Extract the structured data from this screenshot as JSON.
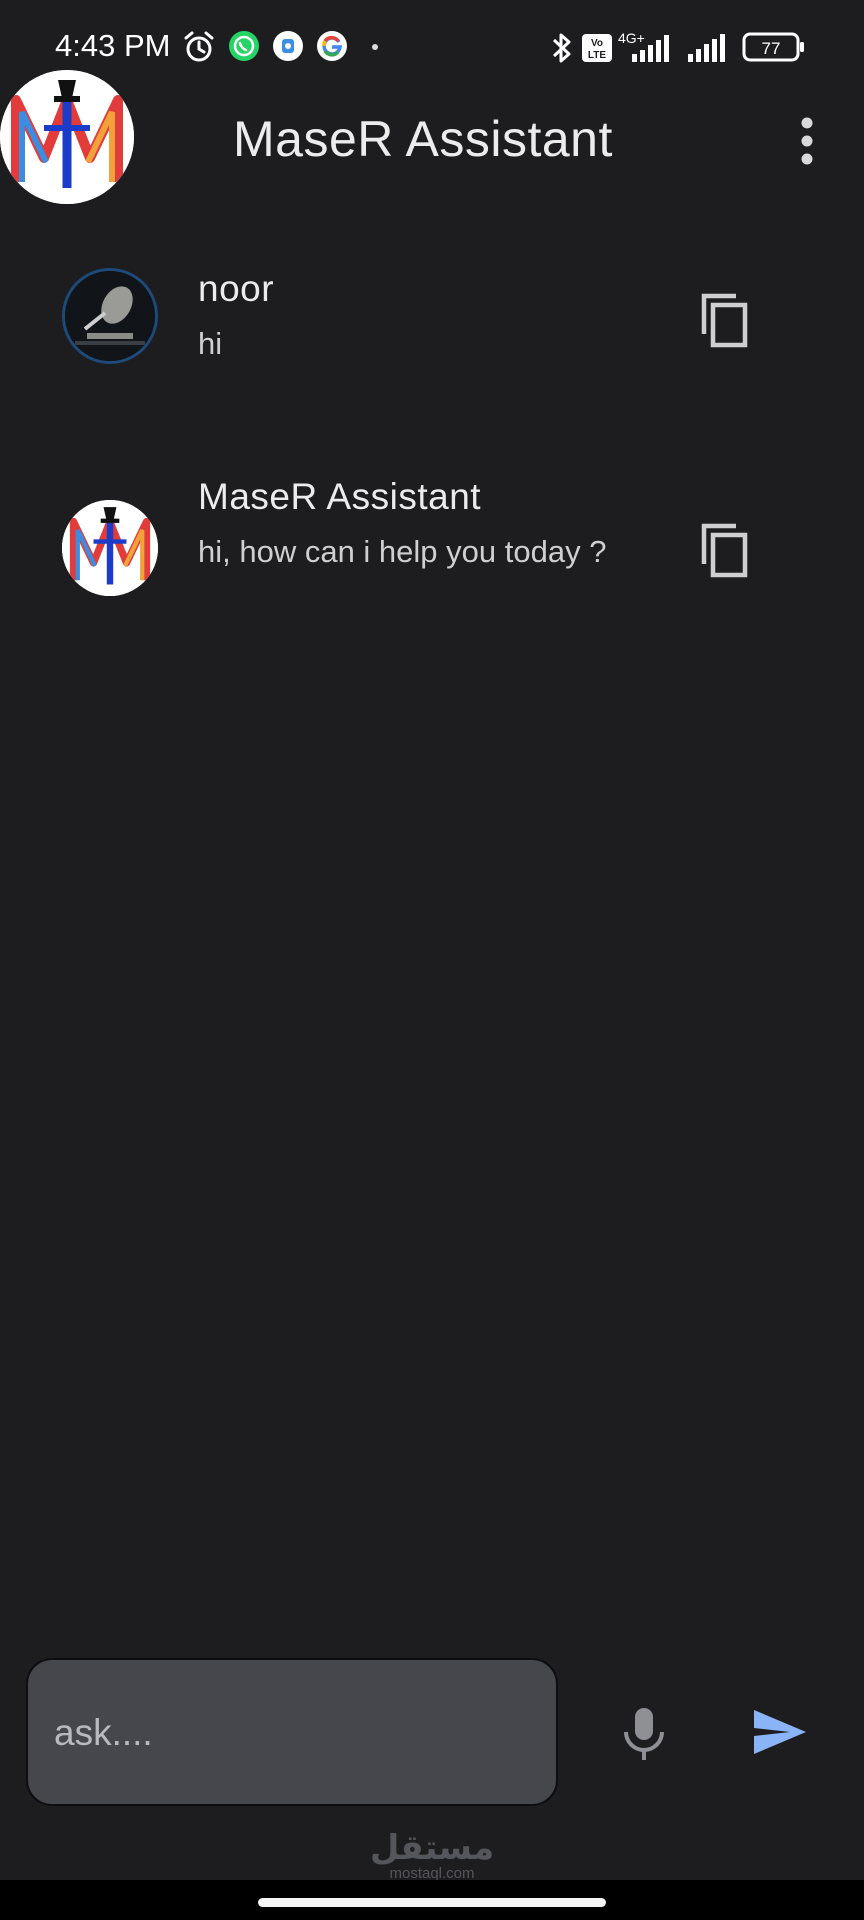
{
  "status_bar": {
    "time": "4:43 PM",
    "network_label": "4G+",
    "battery": "77",
    "icons": [
      "alarm-icon",
      "whatsapp-icon",
      "app-notification-icon",
      "google-icon",
      "bluetooth-icon",
      "volte-icon",
      "signal-icon",
      "battery-icon"
    ]
  },
  "app_bar": {
    "title": "MaseR Assistant",
    "logo_icon": "maser-logo",
    "menu_icon": "more-vert-icon"
  },
  "messages": [
    {
      "sender": "noor",
      "text": "hi",
      "avatar_icon": "user-avatar",
      "action_icon": "copy-icon"
    },
    {
      "sender": "MaseR Assistant",
      "text": "hi, how can i help you today ?",
      "avatar_icon": "maser-logo",
      "action_icon": "copy-icon"
    }
  ],
  "composer": {
    "placeholder": "ask....",
    "value": "",
    "mic_icon": "mic-icon",
    "send_icon": "send-icon"
  },
  "watermark": {
    "arabic": "مستقل",
    "latin": "mostaql.com"
  },
  "colors": {
    "background": "#1d1d20",
    "input_background": "#45474d",
    "send_accent": "#8ab4f8"
  }
}
